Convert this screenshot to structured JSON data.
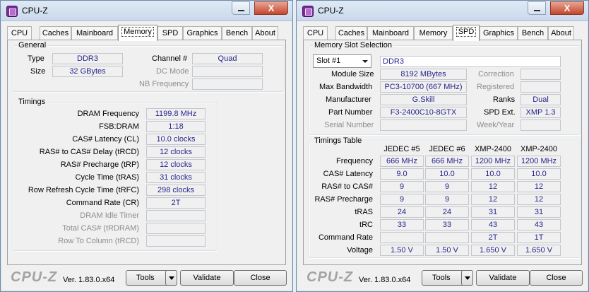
{
  "app_title": "CPU-Z",
  "window_controls": {
    "minimize": "",
    "close": "X"
  },
  "tabs": [
    "CPU",
    "Caches",
    "Mainboard",
    "Memory",
    "SPD",
    "Graphics",
    "Bench",
    "About"
  ],
  "brand": "CPU-Z",
  "version": "Ver. 1.83.0.x64",
  "buttons": {
    "tools": "Tools",
    "validate": "Validate",
    "close": "Close"
  },
  "memory": {
    "general": {
      "legend": "General",
      "type_label": "Type",
      "type_value": "DDR3",
      "size_label": "Size",
      "size_value": "32 GBytes",
      "channel_label": "Channel #",
      "channel_value": "Quad",
      "dc_mode_label": "DC Mode",
      "dc_mode_value": "",
      "nb_freq_label": "NB Frequency",
      "nb_freq_value": ""
    },
    "timings": {
      "legend": "Timings",
      "rows": [
        {
          "label": "DRAM Frequency",
          "value": "1199.8 MHz",
          "enabled": true
        },
        {
          "label": "FSB:DRAM",
          "value": "1:18",
          "enabled": true
        },
        {
          "label": "CAS# Latency (CL)",
          "value": "10.0 clocks",
          "enabled": true
        },
        {
          "label": "RAS# to CAS# Delay (tRCD)",
          "value": "12 clocks",
          "enabled": true
        },
        {
          "label": "RAS# Precharge (tRP)",
          "value": "12 clocks",
          "enabled": true
        },
        {
          "label": "Cycle Time (tRAS)",
          "value": "31 clocks",
          "enabled": true
        },
        {
          "label": "Row Refresh Cycle Time (tRFC)",
          "value": "298 clocks",
          "enabled": true
        },
        {
          "label": "Command Rate (CR)",
          "value": "2T",
          "enabled": true
        },
        {
          "label": "DRAM Idle Timer",
          "value": "",
          "enabled": false
        },
        {
          "label": "Total CAS# (tRDRAM)",
          "value": "",
          "enabled": false
        },
        {
          "label": "Row To Column (tRCD)",
          "value": "",
          "enabled": false
        }
      ]
    }
  },
  "spd": {
    "slot": {
      "legend": "Memory Slot Selection",
      "selected_slot": "Slot #1",
      "mem_type": "DDR3",
      "module_size_label": "Module Size",
      "module_size": "8192 MBytes",
      "max_bw_label": "Max Bandwidth",
      "max_bw": "PC3-10700 (667 MHz)",
      "manufacturer_label": "Manufacturer",
      "manufacturer": "G.Skill",
      "part_label": "Part Number",
      "part": "F3-2400C10-8GTX",
      "serial_label": "Serial Number",
      "serial": "",
      "correction_label": "Correction",
      "correction": "",
      "registered_label": "Registered",
      "registered": "",
      "ranks_label": "Ranks",
      "ranks": "Dual",
      "spd_ext_label": "SPD Ext.",
      "spd_ext": "XMP 1.3",
      "week_year_label": "Week/Year",
      "week_year": ""
    },
    "timings_table": {
      "legend": "Timings Table",
      "columns": [
        "JEDEC #5",
        "JEDEC #6",
        "XMP-2400",
        "XMP-2400"
      ],
      "rows": [
        {
          "label": "Frequency",
          "values": [
            "666 MHz",
            "666 MHz",
            "1200 MHz",
            "1200 MHz"
          ]
        },
        {
          "label": "CAS# Latency",
          "values": [
            "9.0",
            "10.0",
            "10.0",
            "10.0"
          ]
        },
        {
          "label": "RAS# to CAS#",
          "values": [
            "9",
            "9",
            "12",
            "12"
          ]
        },
        {
          "label": "RAS# Precharge",
          "values": [
            "9",
            "9",
            "12",
            "12"
          ]
        },
        {
          "label": "tRAS",
          "values": [
            "24",
            "24",
            "31",
            "31"
          ]
        },
        {
          "label": "tRC",
          "values": [
            "33",
            "33",
            "43",
            "43"
          ]
        },
        {
          "label": "Command Rate",
          "values": [
            "",
            "",
            "2T",
            "1T"
          ]
        },
        {
          "label": "Voltage",
          "values": [
            "1.50 V",
            "1.50 V",
            "1.650 V",
            "1.650 V"
          ]
        }
      ]
    }
  }
}
